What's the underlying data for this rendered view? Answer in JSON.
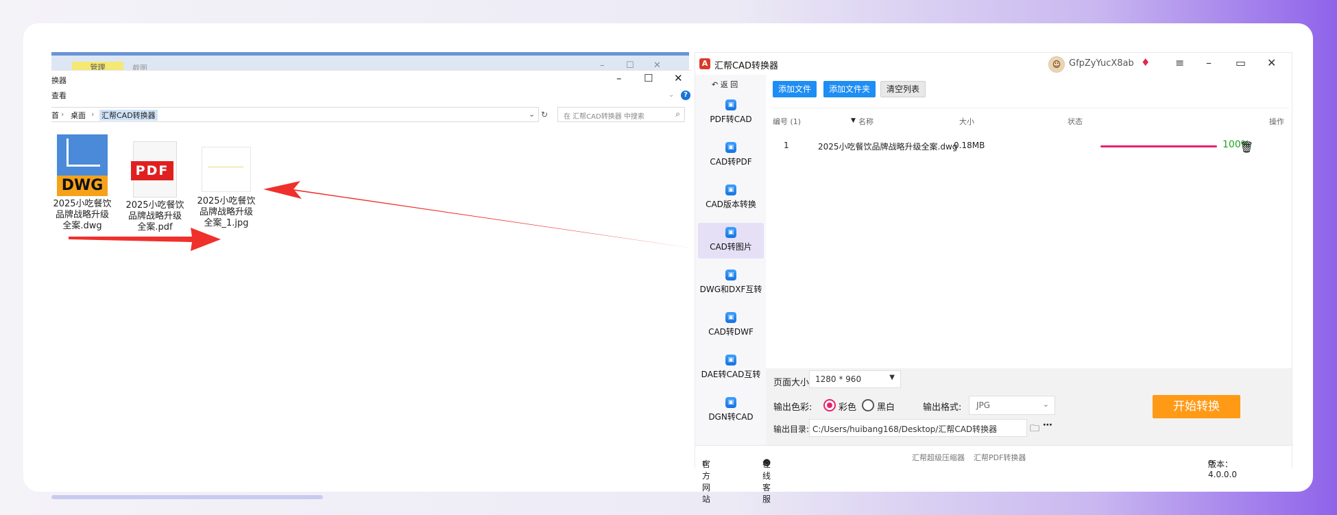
{
  "explorer": {
    "tab_manage": "管理",
    "tab_screenshot": "截图",
    "title": "换器",
    "ribbon_view": "查看",
    "address": {
      "part_home": "首",
      "part_desktop": "桌面",
      "part_current": "汇帮CAD转换器"
    },
    "search_placeholder": "在 汇帮CAD转换器 中搜索",
    "help_label": "?",
    "files": [
      {
        "name": "2025小吃餐饮品牌战略升级全案.dwg",
        "icon": "DWG"
      },
      {
        "name": "2025小吃餐饮品牌战略升级全案.pdf",
        "icon": "PDF"
      },
      {
        "name": "2025小吃餐饮品牌战略升级全案_1.jpg",
        "icon": "JPG"
      }
    ]
  },
  "app": {
    "title": "汇帮CAD转换器",
    "username": "GfpZyYucX8ab",
    "back_label": "返 回",
    "nav": [
      {
        "label": "PDF转CAD",
        "active": false
      },
      {
        "label": "CAD转PDF",
        "active": false
      },
      {
        "label": "CAD版本转换",
        "active": false
      },
      {
        "label": "CAD转图片",
        "active": true
      },
      {
        "label": "DWG和DXF互转",
        "active": false
      },
      {
        "label": "CAD转DWF",
        "active": false
      },
      {
        "label": "DAE转CAD互转",
        "active": false
      },
      {
        "label": "DGN转CAD",
        "active": false
      }
    ],
    "toolbar": {
      "add_file": "添加文件",
      "add_folder": "添加文件夹",
      "clear_list": "清空列表"
    },
    "table": {
      "headers": {
        "index": "编号 (1)",
        "name": "名称",
        "size": "大小",
        "status": "状态",
        "action": "操作"
      },
      "rows": [
        {
          "index": "1",
          "name": "2025小吃餐饮品牌战略升级全案.dwg",
          "size": "0.18MB",
          "progress": 1.0,
          "percent": "100%"
        }
      ]
    },
    "settings": {
      "page_size_label": "页面大小:",
      "page_size_value": "1280 * 960",
      "color_label": "输出色彩:",
      "color_option_color": "彩色",
      "color_option_bw": "黑白",
      "color_selected": "彩色",
      "format_label": "输出格式:",
      "format_value": "JPG",
      "output_dir_label": "输出目录:",
      "output_dir_value": "C:/Users/huibang168/Desktop/汇帮CAD转换器",
      "start_button": "开始转换"
    },
    "statusbar": {
      "official_site": "官方网站",
      "online_service": "在线客服",
      "compressor": "汇帮超级压缩器",
      "pdf_converter": "汇帮PDF转换器",
      "version": "版本：4.0.0.0"
    }
  },
  "colors": {
    "accent_blue": "#1e8df4",
    "progress_pink": "#e8216b",
    "start_orange": "#ff9a17",
    "arrow_red": "#f0302a",
    "percent_green": "#1fa21f"
  }
}
